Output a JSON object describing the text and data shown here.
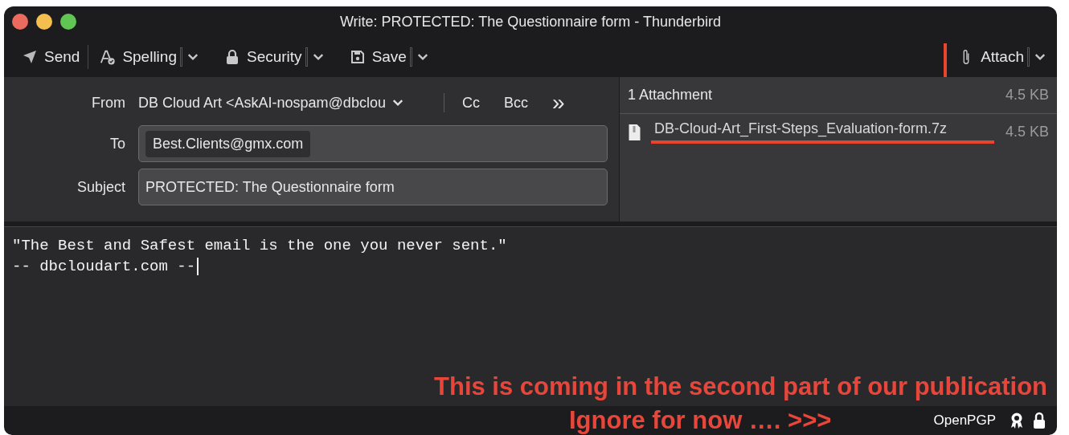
{
  "window": {
    "title": "Write: PROTECTED: The Questionnaire form - Thunderbird"
  },
  "toolbar": {
    "buttons": [
      {
        "label": "Send",
        "has_menu": false
      },
      {
        "label": "Spelling",
        "has_menu": true
      },
      {
        "label": "Security",
        "has_menu": true
      },
      {
        "label": "Save",
        "has_menu": true
      }
    ],
    "attach": {
      "label": "Attach",
      "has_menu": true
    }
  },
  "header": {
    "from": {
      "label": "From",
      "value": "DB Cloud Art <AskAI-nospam@dbclou"
    },
    "cc": "Cc",
    "bcc": "Bcc",
    "more": "»",
    "to": {
      "label": "To",
      "recipients": [
        "Best.Clients@gmx.com"
      ]
    },
    "subject": {
      "label": "Subject",
      "value": "PROTECTED: The Questionnaire form"
    }
  },
  "attachments": {
    "header": "1 Attachment",
    "total_size": "4.5 KB",
    "items": [
      {
        "name": "DB-Cloud-Art_First-Steps_Evaluation-form.7z",
        "size": "4.5 KB",
        "marked": true
      }
    ]
  },
  "body": {
    "lines": [
      "\"The Best and Safest email is the one you never sent.\"",
      "-- dbcloudart.com --"
    ]
  },
  "annotations": [
    "This is coming in the second part of our publication",
    "Ignore for now …. >>>"
  ],
  "status_bar": {
    "label": "OpenPGP"
  }
}
